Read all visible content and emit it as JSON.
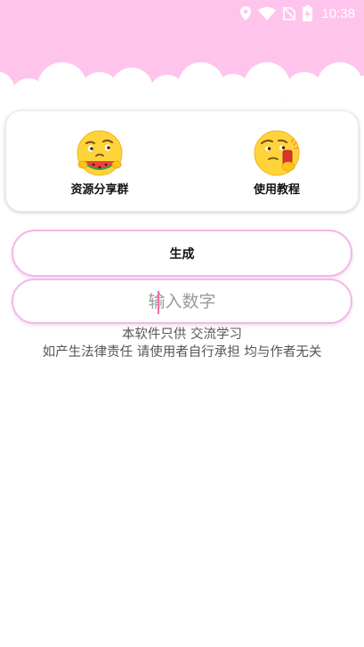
{
  "status_bar": {
    "time": "10:38",
    "icons": [
      "location-icon",
      "wifi-icon",
      "no-sim-icon",
      "battery-charging-icon"
    ]
  },
  "theme": {
    "header_pink": "#ffc4ec",
    "button_border": "#f3b7e8",
    "caret": "#f06aa8"
  },
  "features": [
    {
      "label": "资源分享群",
      "icon": "emoji-eating-watermelon-icon"
    },
    {
      "label": "使用教程",
      "icon": "emoji-skeptical-phone-icon"
    }
  ],
  "generate_button": {
    "label": "生成"
  },
  "number_input": {
    "placeholder": "输入数字",
    "value": ""
  },
  "disclaimer": {
    "line1": "本软件只供 交流学习",
    "line2": "如产生法律责任 请使用者自行承担 均与作者无关"
  }
}
